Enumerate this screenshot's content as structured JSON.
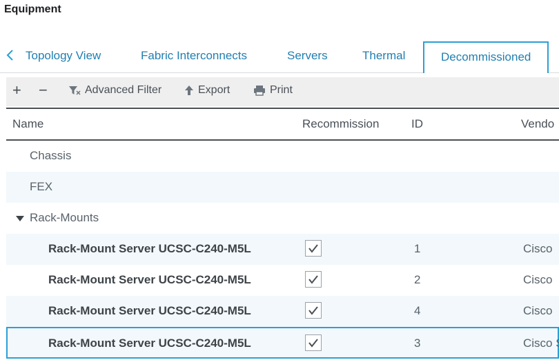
{
  "page": {
    "title": "Equipment"
  },
  "tabs": {
    "back_icon": "chevron-left-icon",
    "items": [
      {
        "label": "Topology View"
      },
      {
        "label": "Fabric Interconnects"
      },
      {
        "label": "Servers"
      },
      {
        "label": "Thermal"
      },
      {
        "label": "Decommissioned",
        "active": true
      }
    ]
  },
  "toolbar": {
    "add_label": "+",
    "remove_label": "−",
    "filter_label": "Advanced Filter",
    "export_label": "Export",
    "print_label": "Print",
    "icons": [
      "plus-icon",
      "minus-icon",
      "filter-icon",
      "export-icon",
      "print-icon"
    ]
  },
  "table": {
    "columns": [
      "Name",
      "Recommission",
      "ID",
      "Vendo"
    ],
    "groups": [
      {
        "label": "Chassis"
      },
      {
        "label": "FEX"
      },
      {
        "label": "Rack-Mounts",
        "expanded": true
      }
    ],
    "rows": [
      {
        "name": "Rack-Mount Server UCSC-C240-M5L",
        "recommission": true,
        "id": "1",
        "vendor": "Cisco"
      },
      {
        "name": "Rack-Mount Server UCSC-C240-M5L",
        "recommission": true,
        "id": "2",
        "vendor": "Cisco"
      },
      {
        "name": "Rack-Mount Server UCSC-C240-M5L",
        "recommission": true,
        "id": "4",
        "vendor": "Cisco"
      },
      {
        "name": "Rack-Mount Server UCSC-C240-M5L",
        "recommission": true,
        "id": "3",
        "vendor": "Cisco S",
        "selected": true
      }
    ]
  },
  "colors": {
    "accent": "#2a9fd6",
    "link": "#1f7fb1",
    "row_alt": "#f2f8fb",
    "toolbar_bg": "#efefef"
  }
}
